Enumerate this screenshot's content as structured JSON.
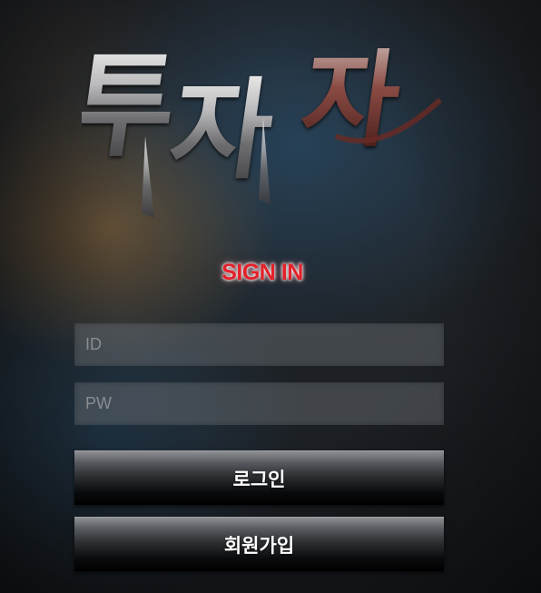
{
  "logo": {
    "text": "투자자"
  },
  "heading": "SIGN IN",
  "form": {
    "id_placeholder": "ID",
    "id_value": "",
    "pw_placeholder": "PW",
    "pw_value": "",
    "login_label": "로그인",
    "signup_label": "회원가입"
  },
  "colors": {
    "accent": "#e4202a",
    "field_bg": "#6e7378",
    "button_top": "#8d8f93",
    "button_bottom": "#000000"
  }
}
